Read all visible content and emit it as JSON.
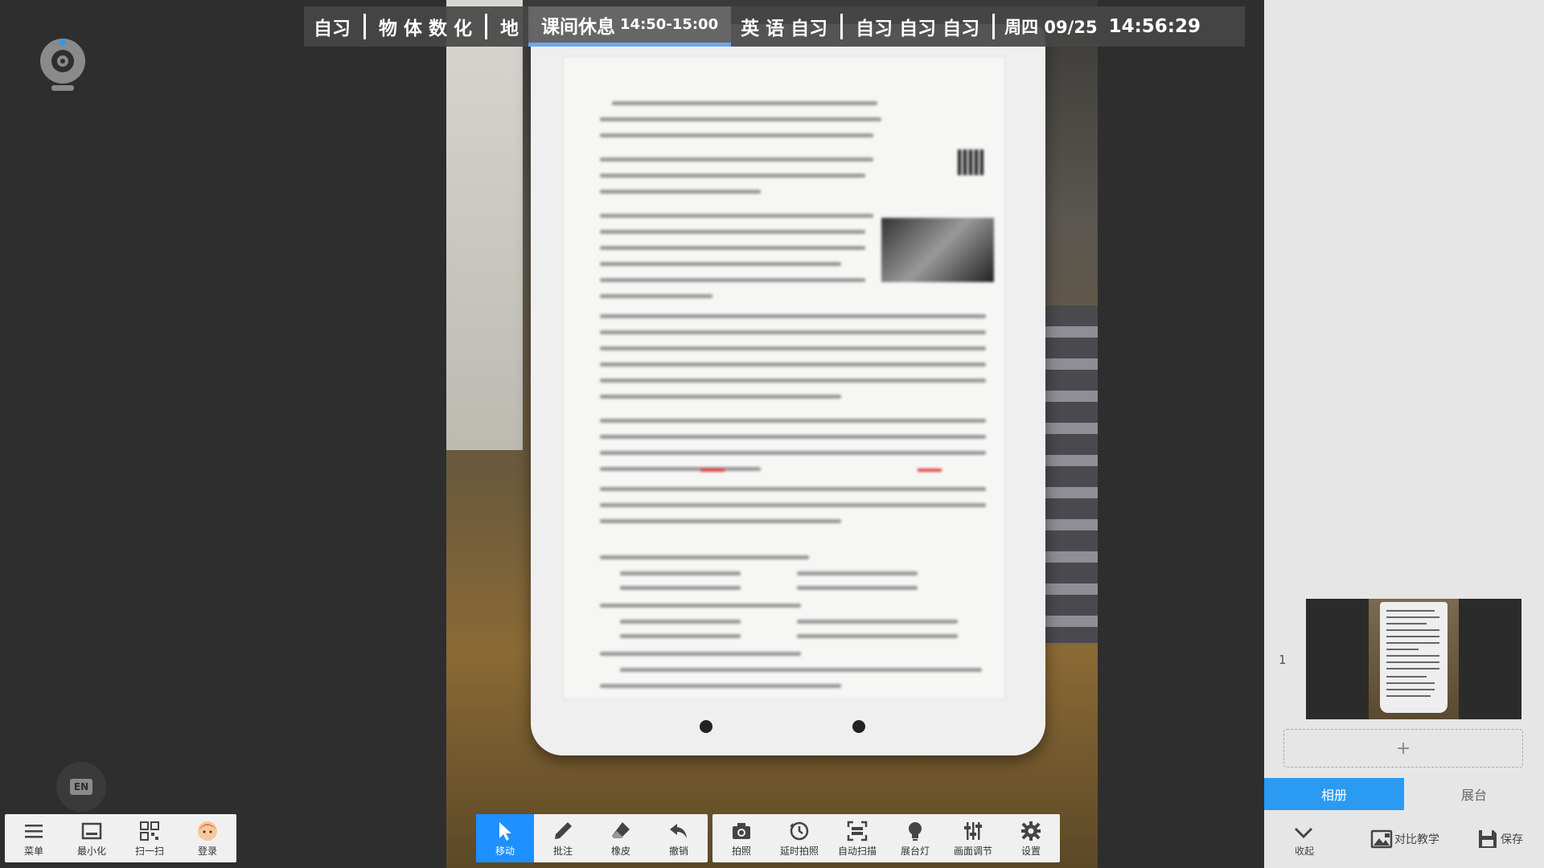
{
  "schedule": {
    "item1": "自习",
    "item2": "物 体 数 化",
    "item3": "地",
    "current_label": "课间休息",
    "current_time": "14:50-15:00",
    "item4": "英 语 自习",
    "item5": "自习 自习 自习",
    "date": "周四 09/25",
    "clock": "14:56:29"
  },
  "left_toolbar": {
    "menu": "菜单",
    "minimize": "最小化",
    "scan": "扫一扫",
    "login": "登录"
  },
  "en_badge": "EN",
  "mid_toolbar": {
    "move": "移动",
    "annotate": "批注",
    "eraser": "橡皮",
    "undo": "撤销"
  },
  "right_toolbar": {
    "photo": "拍照",
    "timer_photo": "延时拍照",
    "auto_scan": "自动扫描",
    "light": "展台灯",
    "adjust": "画面调节",
    "settings": "设置"
  },
  "panel": {
    "thumb_index": "1",
    "add": "+",
    "tab_album": "相册",
    "tab_stage": "展台",
    "collapse": "收起",
    "compare": "对比教学",
    "save": "保存"
  }
}
